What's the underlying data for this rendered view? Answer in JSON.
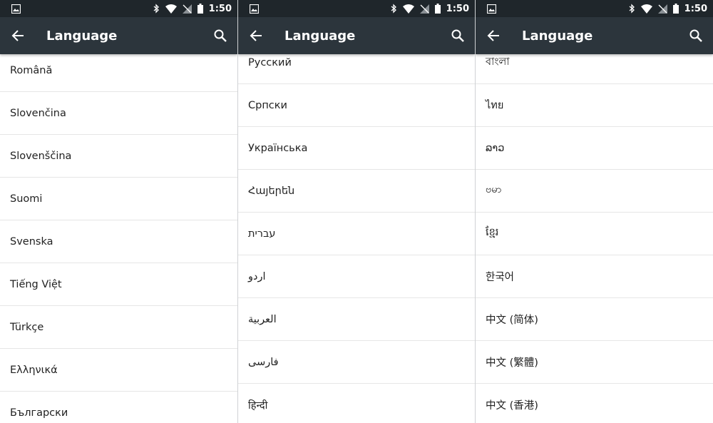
{
  "screens": [
    {
      "status": {
        "time": "1:50"
      },
      "toolbar": {
        "title": "Language"
      },
      "items": [
        "Română",
        "Slovenčina",
        "Slovenščina",
        "Suomi",
        "Svenska",
        "Tiếng Việt",
        "Türkçe",
        "Ελληνικά",
        "Български"
      ]
    },
    {
      "status": {
        "time": "1:50"
      },
      "toolbar": {
        "title": "Language"
      },
      "items": [
        "Русский",
        "Српски",
        "Українська",
        "Հայերեն",
        "עברית",
        "اردو",
        "العربية",
        "فارسی",
        "हिन्दी"
      ]
    },
    {
      "status": {
        "time": "1:50"
      },
      "toolbar": {
        "title": "Language"
      },
      "items": [
        "বাংলা",
        "ไทย",
        "ລາວ",
        "ဗမာ",
        "ខ្មែរ",
        "한국어",
        "中文 (简体)",
        "中文 (繁體)",
        "中文 (香港)"
      ]
    }
  ],
  "colors": {
    "status_bar": "#1f262b",
    "toolbar": "#2c353c",
    "divider": "#e6e6e6",
    "text": "#222222"
  },
  "icons": [
    "image-icon",
    "bluetooth-icon",
    "wifi-icon",
    "no-signal-icon",
    "battery-icon",
    "back-arrow-icon",
    "search-icon"
  ]
}
